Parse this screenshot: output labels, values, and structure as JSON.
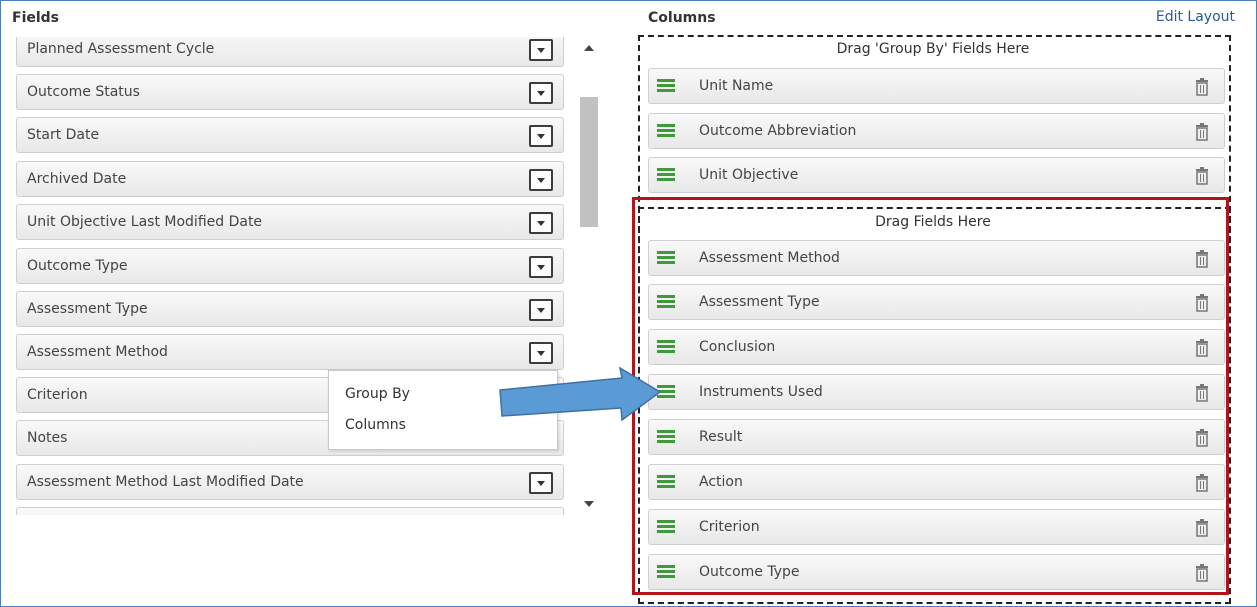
{
  "fields_panel": {
    "title": "Fields",
    "items": [
      "Planned Assessment Cycle",
      "Outcome Status",
      "Start Date",
      "Archived Date",
      "Unit Objective Last Modified Date",
      "Outcome Type",
      "Assessment Type",
      "Assessment Method",
      "Criterion",
      "Notes",
      "Assessment Method Last Modified Date"
    ]
  },
  "popup_menu": {
    "items": [
      "Group By",
      "Columns"
    ]
  },
  "columns_panel": {
    "title": "Columns",
    "edit_layout": "Edit Layout",
    "group_by_hint": "Drag 'Group By' Fields Here",
    "group_by_items": [
      "Unit Name",
      "Outcome Abbreviation",
      "Unit Objective"
    ],
    "fields_hint": "Drag Fields Here",
    "field_items": [
      "Assessment Method",
      "Assessment Type",
      "Conclusion",
      "Instruments Used",
      "Result",
      "Action",
      "Criterion",
      "Outcome Type"
    ]
  },
  "colors": {
    "handle_green": "#3f9a3a",
    "highlight_red": "#b5131c",
    "arrow_blue": "#5b9bd5",
    "link_blue": "#2c5a9c"
  },
  "icons": {
    "drag": "drag-handle-icon",
    "delete": "trash-icon",
    "dropdown": "chevron-down-icon"
  }
}
